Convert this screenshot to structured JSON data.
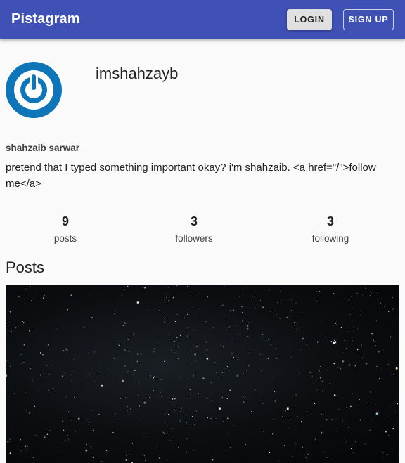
{
  "appbar": {
    "title": "Pistagram",
    "login_label": "LOGIN",
    "signup_label": "SIGN UP"
  },
  "profile": {
    "avatar_icon": "power-icon",
    "username": "imshahzayb",
    "full_name": "shahzaib sarwar",
    "bio": "pretend that I typed something important okay? i'm shahzaib. <a href=\"/\">follow me</a>"
  },
  "stats": [
    {
      "value": "9",
      "label": "posts"
    },
    {
      "value": "3",
      "label": "followers"
    },
    {
      "value": "3",
      "label": "following"
    }
  ],
  "posts": {
    "heading": "Posts",
    "items": [
      {
        "alt_icon": "starry-night-image"
      }
    ]
  },
  "colors": {
    "appbar": "#3f51b5",
    "avatar_blue": "#0e75b8",
    "login_bg": "#e0e0e0"
  }
}
